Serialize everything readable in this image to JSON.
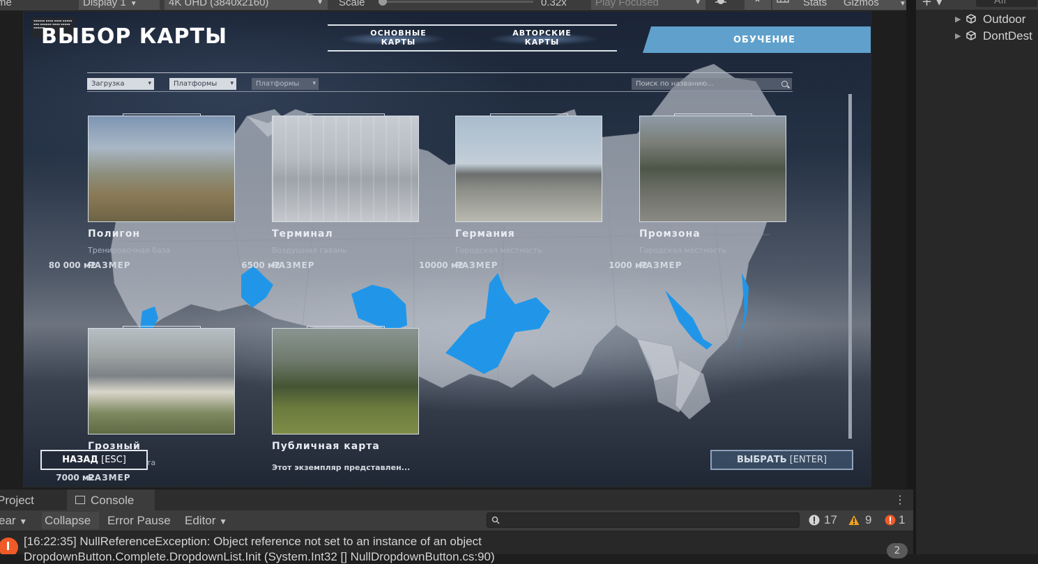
{
  "toolbar": {
    "game_label": "me",
    "display": "Display 1",
    "resolution": "4K UHD (3840x2160)",
    "scale_label": "Scale",
    "scale_value": "0.32x",
    "play_mode": "Play Focused",
    "stats": "Stats",
    "gizmos": "Gizmos"
  },
  "hierarchy": {
    "search_placeholder": "All",
    "items": [
      {
        "label": "Outdoor"
      },
      {
        "label": "DontDest"
      }
    ]
  },
  "game": {
    "title": "ВЫБОР КАРТЫ",
    "tabs": [
      {
        "label": "ОСНОВНЫЕ КАРТЫ"
      },
      {
        "label": "АВТОРСКИЕ КАРТЫ"
      },
      {
        "label": "ОБУЧЕНИЕ"
      }
    ],
    "filters": [
      {
        "label": "Загрузка"
      },
      {
        "label": "Платформы"
      },
      {
        "label": "Платформы"
      }
    ],
    "search_placeholder": "Поиск по названию...",
    "size_label": "РАЗМЕР",
    "maps": [
      {
        "name": "Полигон",
        "subtitle": "Тренировочная база",
        "size": "80 000 м2"
      },
      {
        "name": "Терминал",
        "subtitle": "Воздушная гавань",
        "size": "6500 м2"
      },
      {
        "name": "Германия",
        "subtitle": "Городская местность",
        "size": "10000 м2"
      },
      {
        "name": "Промзона",
        "subtitle": "Городская местность",
        "size": "1000 м2"
      },
      {
        "name": "Грозный",
        "subtitle": "та",
        "size": "7000 м2"
      },
      {
        "name": "Публичная карта",
        "subtitle": "Этот экземпляр представлен...",
        "size": ""
      }
    ],
    "back_button": "НАЗАД",
    "back_hint": "[ESC]",
    "select_button": "ВЫБРАТЬ",
    "select_hint": "[ENTER]",
    "colors": {
      "accent": "#5fa1cc",
      "highlight_region": "#2196e8"
    }
  },
  "console": {
    "tabs": [
      {
        "label": "Project"
      },
      {
        "label": "Console"
      }
    ],
    "toolbar": {
      "clear": "ear",
      "collapse": "Collapse",
      "error_pause": "Error Pause",
      "editor": "Editor"
    },
    "counts": {
      "info": "17",
      "warnings": "9",
      "errors": "1"
    },
    "log_line": "[16:22:35] NullReferenceException: Object reference not set to an instance of an object",
    "log_line2": "DropdownButton.Complete.DropdownList.Init (System.Int32 [] NullDropdownButton.cs:90)",
    "log_count": "2"
  }
}
